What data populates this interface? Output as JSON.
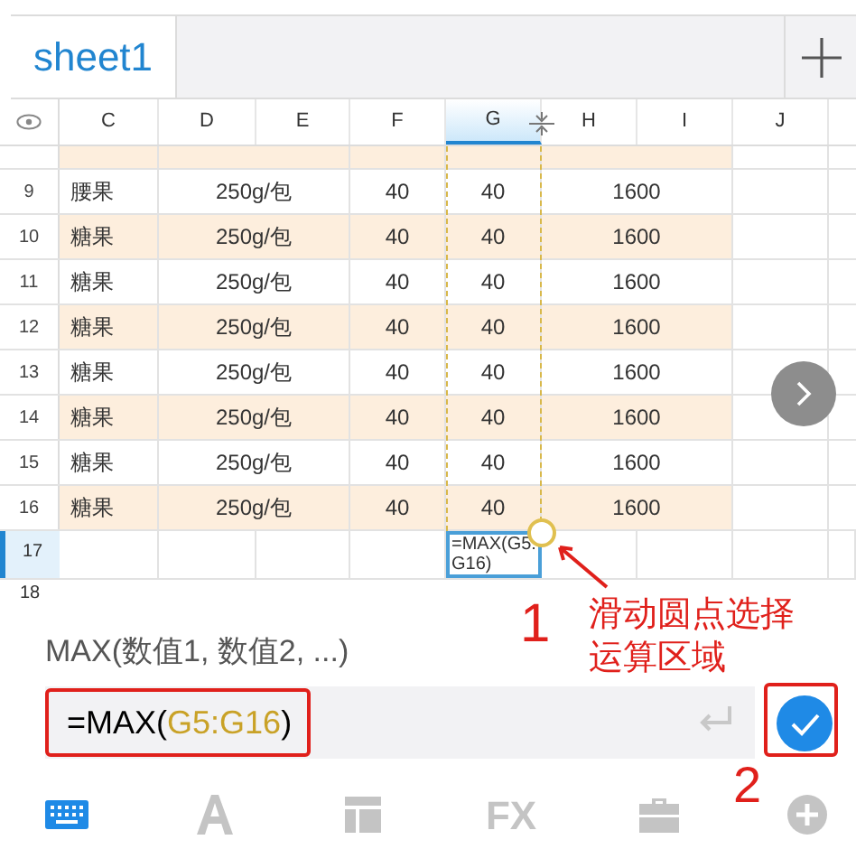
{
  "sheet_tabs": [
    {
      "label": "sheet1",
      "selected": true
    }
  ],
  "columns": [
    {
      "label": "C",
      "selected": false
    },
    {
      "label": "D",
      "selected": false
    },
    {
      "label": "E",
      "selected": false
    },
    {
      "label": "F",
      "selected": false
    },
    {
      "label": "G",
      "selected": true
    },
    {
      "label": "H",
      "selected": false
    },
    {
      "label": "I",
      "selected": false
    },
    {
      "label": "J",
      "selected": false
    }
  ],
  "rows": [
    {
      "shaded": true
    },
    {
      "number": "9",
      "c": "腰果",
      "d": "250g/包",
      "f": "40",
      "g": "40",
      "h": "1600",
      "shaded": false
    },
    {
      "number": "10",
      "c": "糖果",
      "d": "250g/包",
      "f": "40",
      "g": "40",
      "h": "1600",
      "shaded": true
    },
    {
      "number": "11",
      "c": "糖果",
      "d": "250g/包",
      "f": "40",
      "g": "40",
      "h": "1600",
      "shaded": false
    },
    {
      "number": "12",
      "c": "糖果",
      "d": "250g/包",
      "f": "40",
      "g": "40",
      "h": "1600",
      "shaded": true
    },
    {
      "number": "13",
      "c": "糖果",
      "d": "250g/包",
      "f": "40",
      "g": "40",
      "h": "1600",
      "shaded": false
    },
    {
      "number": "14",
      "c": "糖果",
      "d": "250g/包",
      "f": "40",
      "g": "40",
      "h": "1600",
      "shaded": true
    },
    {
      "number": "15",
      "c": "糖果",
      "d": "250g/包",
      "f": "40",
      "g": "40",
      "h": "1600",
      "shaded": false
    },
    {
      "number": "16",
      "c": "糖果",
      "d": "250g/包",
      "f": "40",
      "g": "40",
      "h": "1600",
      "shaded": true
    }
  ],
  "active_row": {
    "number": "17",
    "g": "=MAX(G5:G16)"
  },
  "next_row": {
    "number": "18"
  },
  "function_hint": "MAX(数值1, 数值2, ...)",
  "formula": [
    {
      "text": "=MAX(",
      "kind": "plain"
    },
    {
      "text": "G5:G16",
      "kind": "reference"
    },
    {
      "text": ")",
      "kind": "plain"
    }
  ],
  "annotations": [
    {
      "number": "1",
      "lines": [
        "滑动圆点选择",
        "运算区域"
      ]
    },
    {
      "number": "2"
    }
  ],
  "toolbar": [
    {
      "kind": "keyboard",
      "selected": true
    },
    {
      "kind": "font",
      "selected": false
    },
    {
      "kind": "layout",
      "selected": false
    },
    {
      "kind": "fx",
      "label": "FX",
      "selected": false
    },
    {
      "kind": "briefcase",
      "selected": false
    },
    {
      "kind": "add",
      "selected": false
    }
  ]
}
